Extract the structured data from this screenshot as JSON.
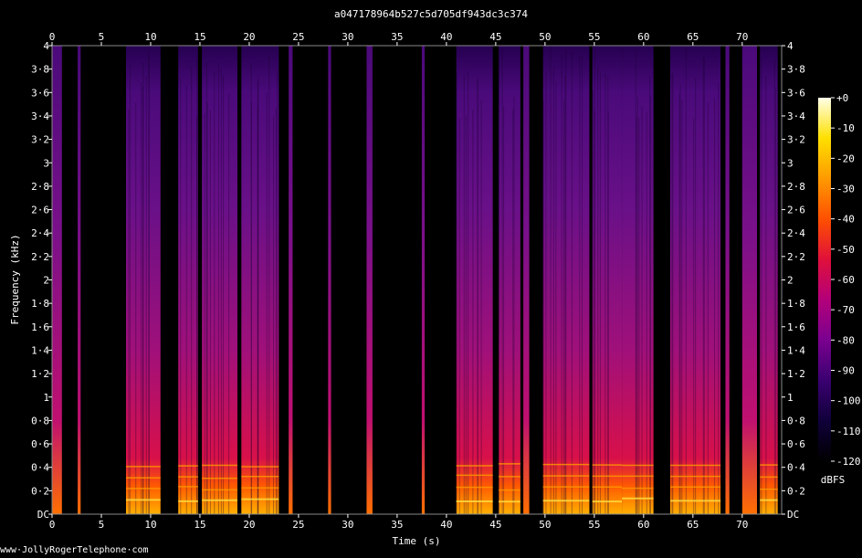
{
  "chart_data": {
    "type": "heatmap",
    "title": "a047178964b527c5d705df943dc3c374",
    "xlabel": "Time (s)",
    "ylabel": "Frequency (kHz)",
    "xlim": [
      0,
      74
    ],
    "ylim": [
      0,
      4
    ],
    "x_ticks": [
      "0",
      "5",
      "10",
      "15",
      "20",
      "25",
      "30",
      "35",
      "40",
      "45",
      "50",
      "55",
      "60",
      "65",
      "70"
    ],
    "x_tick_values": [
      0,
      5,
      10,
      15,
      20,
      25,
      30,
      35,
      40,
      45,
      50,
      55,
      60,
      65,
      70
    ],
    "y_ticks": [
      "DC",
      "0·2",
      "0·4",
      "0·6",
      "0·8",
      "1",
      "1·2",
      "1·4",
      "1·6",
      "1·8",
      "2",
      "2·2",
      "2·4",
      "2·6",
      "2·8",
      "3",
      "3·2",
      "3·4",
      "3·6",
      "3·8",
      "4"
    ],
    "y_tick_values": [
      0,
      0.2,
      0.4,
      0.6,
      0.8,
      1,
      1.2,
      1.4,
      1.6,
      1.8,
      2,
      2.2,
      2.4,
      2.6,
      2.8,
      3,
      3.2,
      3.4,
      3.6,
      3.8,
      4
    ],
    "colorbar": {
      "label": "dBFS",
      "ticks": [
        "+0",
        "-10",
        "-20",
        "-30",
        "-40",
        "-50",
        "-60",
        "-70",
        "-80",
        "-90",
        "-100",
        "-110",
        "-120"
      ],
      "tick_values": [
        0,
        -10,
        -20,
        -30,
        -40,
        -50,
        -60,
        -70,
        -80,
        -90,
        -100,
        -110,
        -120
      ],
      "range": [
        -120,
        0
      ],
      "colors": [
        "#000000",
        "#10003a",
        "#3a0070",
        "#7a008f",
        "#b3007a",
        "#e0103a",
        "#ff5000",
        "#ff9a00",
        "#ffe000",
        "#ffffe8"
      ]
    },
    "active_segments_s": [
      [
        0.0,
        1.0
      ],
      [
        2.6,
        2.9
      ],
      [
        7.5,
        11.0
      ],
      [
        12.8,
        14.8
      ],
      [
        15.2,
        18.8
      ],
      [
        19.2,
        23.0
      ],
      [
        24.0,
        24.4
      ],
      [
        28.0,
        28.3
      ],
      [
        31.9,
        32.5
      ],
      [
        37.5,
        37.8
      ],
      [
        41.0,
        44.7
      ],
      [
        45.3,
        47.5
      ],
      [
        47.8,
        48.4
      ],
      [
        49.8,
        54.5
      ],
      [
        54.8,
        57.8
      ],
      [
        57.8,
        61.0
      ],
      [
        62.7,
        67.8
      ],
      [
        68.3,
        68.7
      ],
      [
        70.0,
        71.5
      ],
      [
        71.8,
        73.6
      ]
    ]
  },
  "watermark": "www·JollyRogerTelephone·com"
}
